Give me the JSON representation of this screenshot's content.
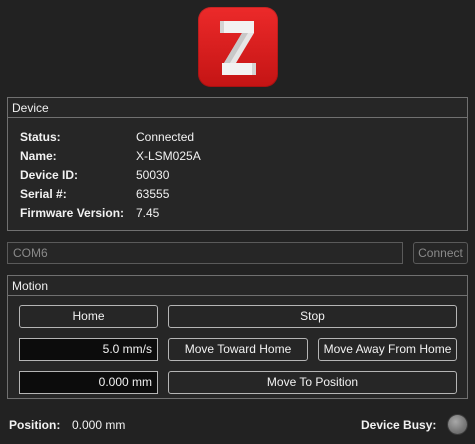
{
  "colors": {
    "background": "#222222",
    "logo_red": "#e01e1e",
    "busy_indicator_idle": "#8a8a8a"
  },
  "logo": {
    "icon": "z-logo-icon"
  },
  "device": {
    "title": "Device",
    "rows": [
      {
        "label": "Status:",
        "value": "Connected"
      },
      {
        "label": "Name:",
        "value": "X-LSM025A"
      },
      {
        "label": "Device ID:",
        "value": "50030"
      },
      {
        "label": "Serial #:",
        "value": "63555"
      },
      {
        "label": "Firmware Version:",
        "value": "7.45"
      }
    ]
  },
  "port": {
    "value": "COM6",
    "connect_label": "Connect"
  },
  "motion": {
    "title": "Motion",
    "home_label": "Home",
    "stop_label": "Stop",
    "speed_value": "5.0 mm/s",
    "move_toward_home_label": "Move Toward Home",
    "move_away_label": "Move Away From Home",
    "position_value": "0.000 mm",
    "move_to_position_label": "Move To Position"
  },
  "status": {
    "position_label": "Position:",
    "position_value": "0.000 mm",
    "busy_label": "Device Busy:"
  }
}
